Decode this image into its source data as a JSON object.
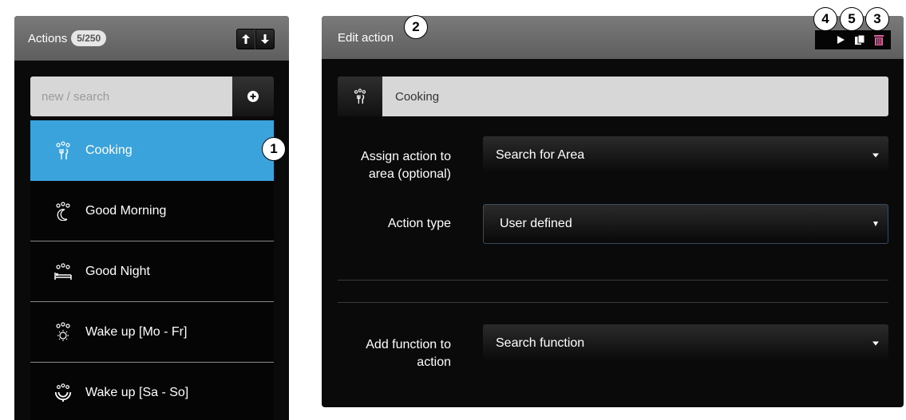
{
  "actions_panel": {
    "title": "Actions",
    "count": "5/250",
    "search": {
      "placeholder": "new / search",
      "value": ""
    },
    "items": [
      {
        "label": "Cooking",
        "icon": "cooking-icon",
        "selected": true
      },
      {
        "label": "Good Morning",
        "icon": "moon-icon",
        "selected": false
      },
      {
        "label": "Good Night",
        "icon": "bed-icon",
        "selected": false
      },
      {
        "label": "Wake up [Mo - Fr]",
        "icon": "sun-icon",
        "selected": false
      },
      {
        "label": "Wake up [Sa - So]",
        "icon": "sunrise-icon",
        "selected": false
      }
    ]
  },
  "edit_panel": {
    "title": "Edit action",
    "name": {
      "value": "Cooking",
      "icon": "cooking-icon"
    },
    "area": {
      "label": "Assign action to area (optional)",
      "label_line1": "Assign action to",
      "label_line2": "area (optional)",
      "value": "Search for Area"
    },
    "action_type": {
      "label": "Action type",
      "value": "User defined"
    },
    "function": {
      "label": "Add function to action",
      "label_line1": "Add function to",
      "label_line2": "action",
      "value": "Search function"
    }
  },
  "callouts": [
    "1",
    "2",
    "3",
    "4",
    "5"
  ],
  "colors": {
    "selected": "#3aa3dc",
    "header": "#6a6a6a",
    "panel": "#0a0a0a",
    "input": "#d7d7d7"
  }
}
